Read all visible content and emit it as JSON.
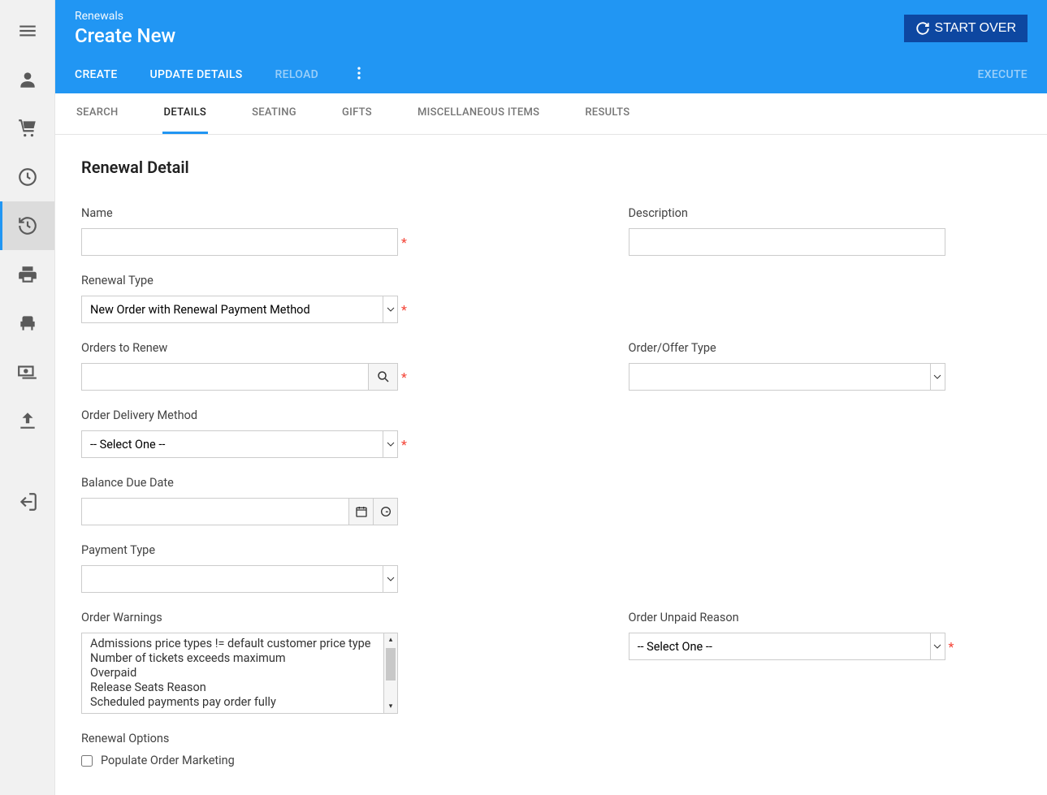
{
  "header": {
    "breadcrumb": "Renewals",
    "title": "Create New",
    "start_over": "START OVER"
  },
  "actions": {
    "create": "CREATE",
    "update": "UPDATE DETAILS",
    "reload": "RELOAD",
    "execute": "EXECUTE"
  },
  "tabs": {
    "search": "SEARCH",
    "details": "DETAILS",
    "seating": "SEATING",
    "gifts": "GIFTS",
    "misc": "MISCELLANEOUS ITEMS",
    "results": "RESULTS"
  },
  "section": {
    "heading": "Renewal Detail"
  },
  "labels": {
    "name": "Name",
    "description": "Description",
    "renewal_type": "Renewal Type",
    "orders_to_renew": "Orders to Renew",
    "order_offer_type": "Order/Offer Type",
    "order_delivery_method": "Order Delivery Method",
    "balance_due_date": "Balance Due Date",
    "payment_type": "Payment Type",
    "order_warnings": "Order Warnings",
    "order_unpaid_reason": "Order Unpaid Reason",
    "renewal_options": "Renewal Options",
    "populate_marketing": "Populate Order Marketing"
  },
  "values": {
    "renewal_type": "New Order with Renewal Payment Method",
    "order_delivery_method": "-- Select One --",
    "order_unpaid_reason": "-- Select One --"
  },
  "warnings": [
    "Admissions price types != default customer price type",
    "Number of tickets exceeds maximum",
    "Overpaid",
    "Release Seats Reason",
    "Scheduled payments pay order fully"
  ]
}
